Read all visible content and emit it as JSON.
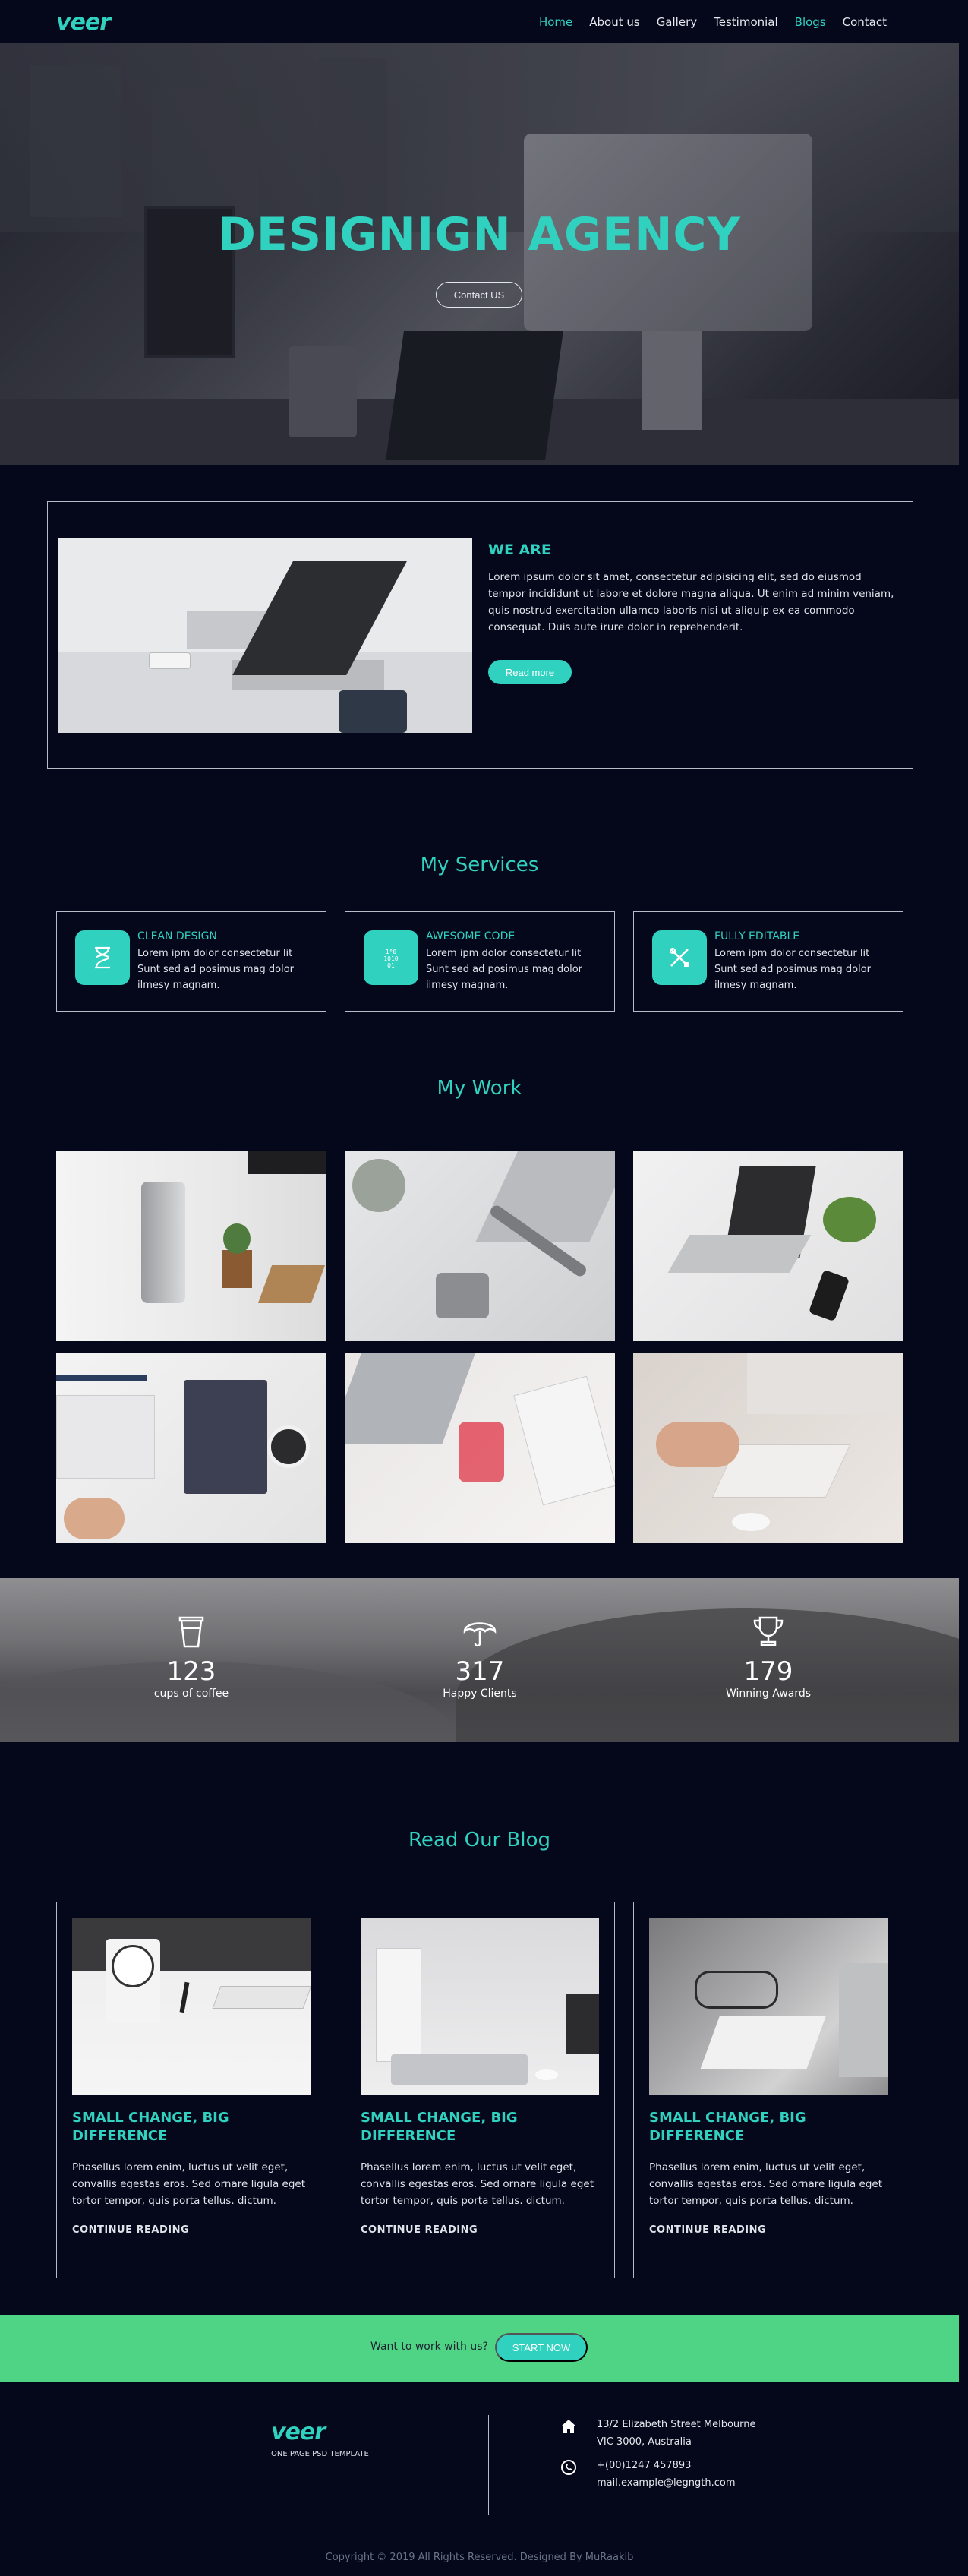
{
  "brand": {
    "logo": "veer",
    "tagline": "ONE PAGE PSD TEMPLATE",
    "accent": "#31d1c0",
    "background": "#05071a",
    "cta_color": "#4fd486"
  },
  "nav": {
    "items": [
      {
        "label": "Home",
        "active": true
      },
      {
        "label": "About us",
        "active": false
      },
      {
        "label": "Gallery",
        "active": false
      },
      {
        "label": "Testimonial",
        "active": false
      },
      {
        "label": "Blogs",
        "active": true
      },
      {
        "label": "Contact",
        "active": false
      }
    ]
  },
  "hero": {
    "title": "DESIGNIGN AGENCY",
    "button": "Contact US"
  },
  "about": {
    "title": "WE ARE",
    "text": "Lorem ipsum dolor sit amet, consectetur adipisicing elit, sed do eiusmod tempor incididunt ut labore et dolore magna aliqua. Ut enim ad minim veniam, quis nostrud exercitation ullamco laboris nisi ut aliquip ex ea commodo consequat. Duis aute irure dolor in reprehenderit.",
    "button": "Read more"
  },
  "services": {
    "title": "My Services",
    "items": [
      {
        "icon": "hourglass-icon",
        "title": "CLEAN DESIGN",
        "text": "Lorem ipm dolor consectetur lit Sunt sed ad posimus mag dolor ilmesy magnam."
      },
      {
        "icon": "binary-code-icon",
        "title": "AWESOME CODE",
        "text": "Lorem ipm dolor consectetur lit Sunt sed ad posimus mag dolor ilmesy magnam."
      },
      {
        "icon": "tools-icon",
        "title": "FULLY EDITABLE",
        "text": "Lorem ipm dolor consectetur lit Sunt sed ad posimus mag dolor ilmesy magnam."
      }
    ]
  },
  "work": {
    "title": "My Work"
  },
  "stats": [
    {
      "icon": "coffee-cup-icon",
      "number": "123",
      "label": "cups of coffee"
    },
    {
      "icon": "umbrella-icon",
      "number": "317",
      "label": "Happy Clients"
    },
    {
      "icon": "trophy-icon",
      "number": "179",
      "label": "Winning Awards"
    }
  ],
  "blog": {
    "title": "Read Our Blog",
    "posts": [
      {
        "title": "SMALL CHANGE, BIG DIFFERENCE",
        "text": "Phasellus lorem enim, luctus ut velit eget, convallis egestas eros. Sed ornare ligula eget tortor tempor, quis porta tellus. dictum.",
        "link": "CONTINUE READING"
      },
      {
        "title": "SMALL CHANGE, BIG DIFFERENCE",
        "text": "Phasellus lorem enim, luctus ut velit eget, convallis egestas eros. Sed ornare ligula eget tortor tempor, quis porta tellus. dictum.",
        "link": "CONTINUE READING"
      },
      {
        "title": "SMALL CHANGE, BIG DIFFERENCE",
        "text": "Phasellus lorem enim, luctus ut velit eget, convallis egestas eros. Sed ornare ligula eget tortor tempor, quis porta tellus. dictum.",
        "link": "CONTINUE READING"
      }
    ]
  },
  "cta": {
    "text": "Want to work with us?",
    "button": "START NOW"
  },
  "footer": {
    "address_line1": "13/2 Elizabeth Street Melbourne",
    "address_line2": "VIC 3000, Australia",
    "phone": "+(00)1247 457893",
    "email": "mail.example@legngth.com",
    "copyright": "Copyright © 2019 All Rights Reserved. Designed By MuRaakib"
  }
}
